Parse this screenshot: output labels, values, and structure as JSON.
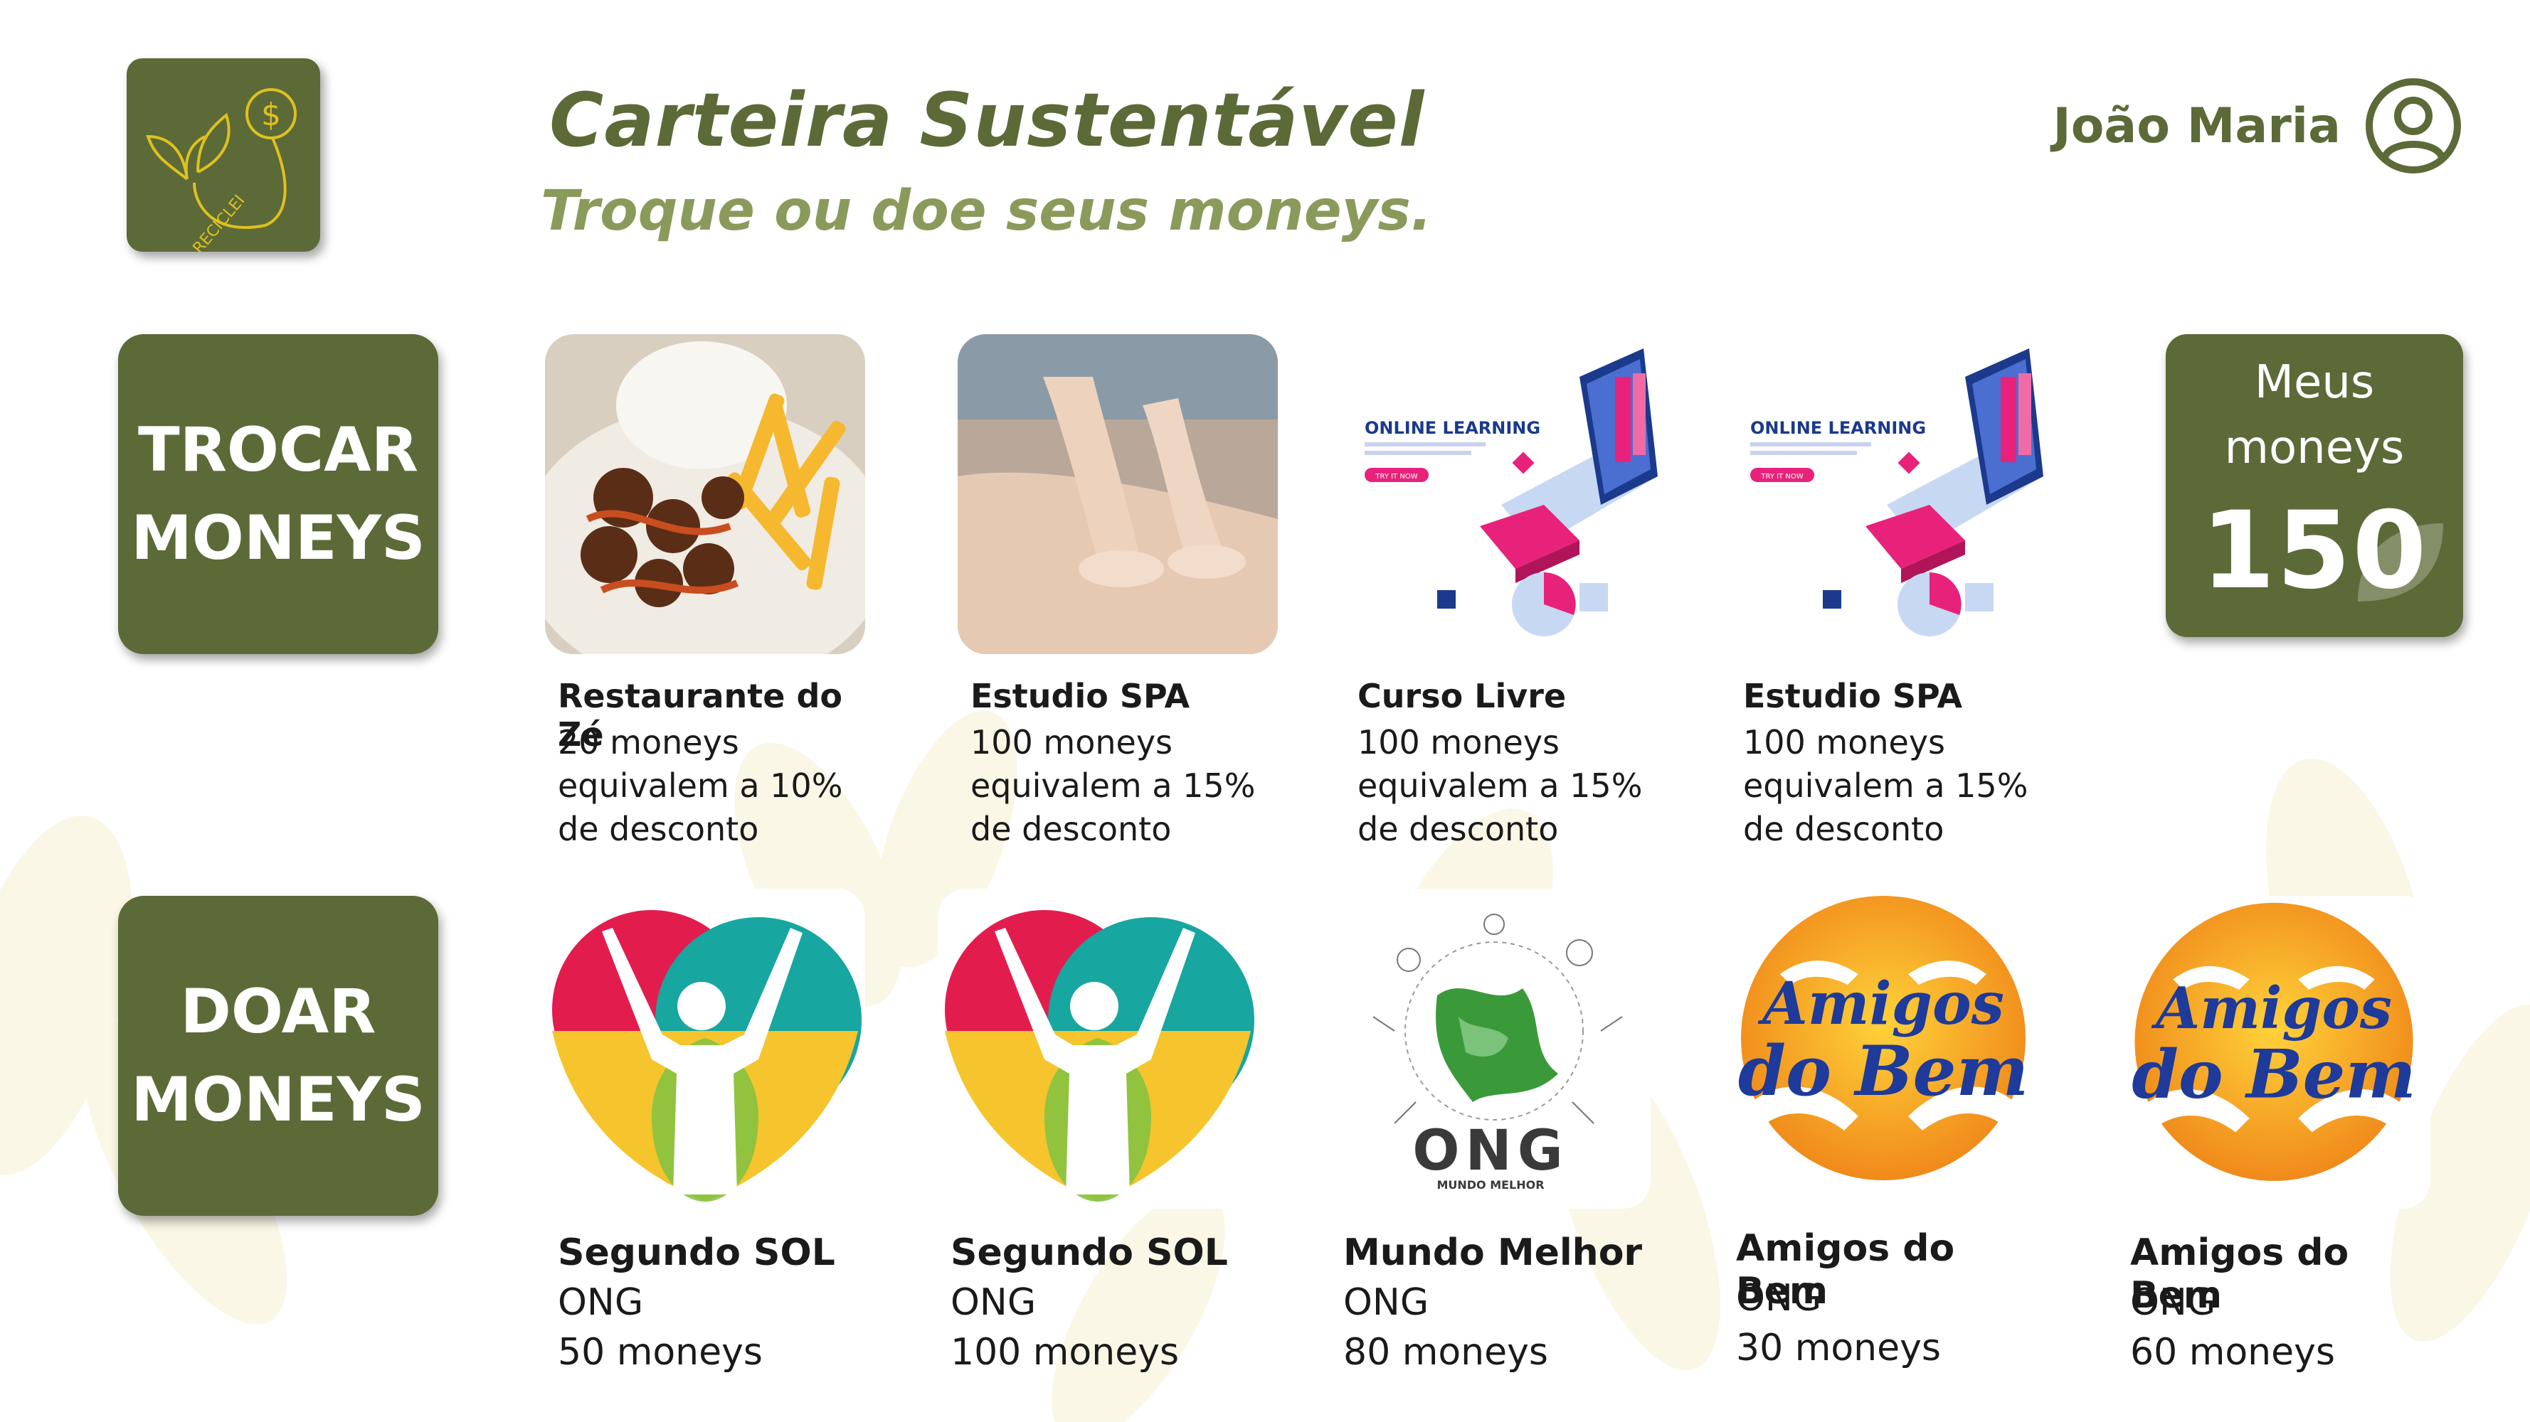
{
  "header": {
    "title": "Carteira Sustentável",
    "subtitle": "Troque ou doe seus moneys.",
    "logo_text": "RECICLEI",
    "user_name": "João Maria"
  },
  "actions": {
    "trade_label": "TROCAR\nMONEYS",
    "donate_label": "DOAR\nMONEYS"
  },
  "wallet": {
    "label": "Meus\nmoneys",
    "value": "150"
  },
  "offers": [
    {
      "name": "Restaurante do Zé",
      "desc": "20 moneys equivalem a 10% de desconto",
      "image": "food-photo"
    },
    {
      "name": "Estudio SPA",
      "desc": "100 moneys equivalem a 15% de desconto",
      "image": "massage-photo"
    },
    {
      "name": "Curso Livre",
      "desc": "100 moneys equivalem a 15% de desconto",
      "image": "online-learning-illustration",
      "image_heading": "ONLINE LEARNING",
      "image_button": "TRY IT NOW"
    },
    {
      "name": "Estudio SPA",
      "desc": "100 moneys equivalem a 15% de desconto",
      "image": "online-learning-illustration",
      "image_heading": "ONLINE LEARNING",
      "image_button": "TRY IT NOW"
    }
  ],
  "ngos": [
    {
      "name": "Segundo SOL",
      "type": "ONG",
      "price": "50 moneys",
      "logo": "segundo-sol-logo"
    },
    {
      "name": "Segundo SOL",
      "type": "ONG",
      "price": "100 moneys",
      "logo": "segundo-sol-logo"
    },
    {
      "name": "Mundo Melhor",
      "type": "ONG",
      "price": "80 moneys",
      "logo": "ong-mundo-melhor-logo",
      "logo_text": "ONG",
      "logo_subtext": "MUNDO MELHOR"
    },
    {
      "name": "Amigos do Bem",
      "type": "ONG",
      "price": "30 moneys",
      "logo": "amigos-do-bem-logo",
      "logo_line1": "Amigos",
      "logo_line2": "do Bem"
    },
    {
      "name": "Amigos do Bem",
      "type": "ONG",
      "price": "60 moneys",
      "logo": "amigos-do-bem-logo",
      "logo_line1": "Amigos",
      "logo_line2": "do Bem"
    }
  ],
  "colors": {
    "primary": "#5b6a37",
    "accent_light": "#8a9a5b"
  }
}
